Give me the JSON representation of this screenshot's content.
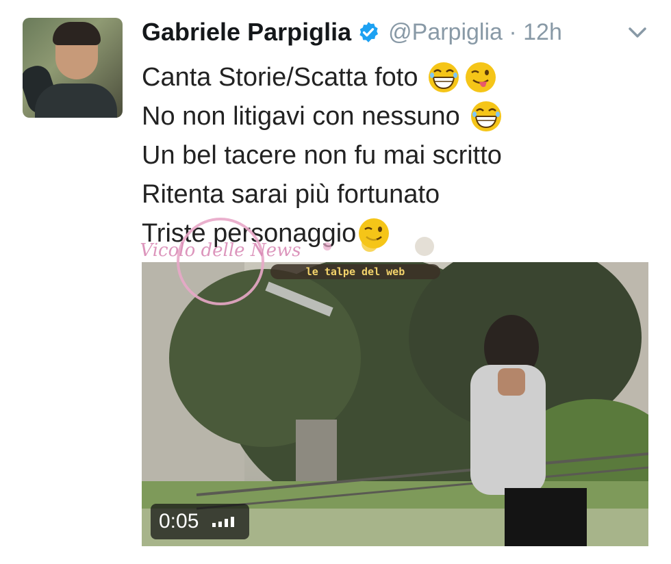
{
  "author": {
    "name": "Gabriele Parpiglia",
    "handle": "@Parpiglia · 12h"
  },
  "tweet_lines": [
    "Canta Storie/Scatta foto",
    "No non litigavi con nessuno",
    "Un bel tacere non fu mai scritto",
    "Ritenta sarai più fortunato",
    "Triste personaggio"
  ],
  "video": {
    "duration": "0:05"
  },
  "watermarks": {
    "vicolo": "Vicolo delle News",
    "talpe": "le talpe del web"
  },
  "colors": {
    "verified": "#1da1f2",
    "handle": "#8899a6",
    "text": "#222222",
    "emoji": "#f5c518"
  },
  "icons": [
    "verified-badge-icon",
    "chevron-down-icon",
    "laughing-emoji-icon",
    "winking-tongue-emoji-icon",
    "winking-smile-emoji-icon",
    "volume-bars-icon"
  ]
}
